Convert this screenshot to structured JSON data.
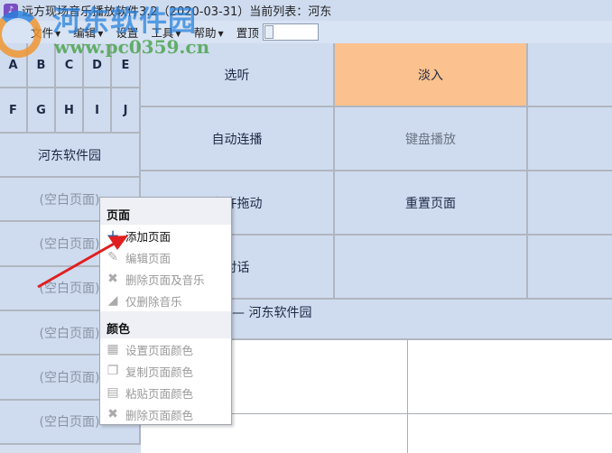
{
  "titlebar": {
    "title": "远方现场音乐播放软件3.2（2020-03-31）",
    "current_list": "当前列表：河东"
  },
  "menu": {
    "items": [
      "文件",
      "编辑",
      "设置",
      "工具",
      "帮助"
    ],
    "pin_label": "置顶"
  },
  "letters": [
    "A",
    "B",
    "C",
    "D",
    "E",
    "F",
    "G",
    "H",
    "I",
    "J"
  ],
  "pages": [
    "河东软件园",
    "(空白页面)",
    "(空白页面)",
    "(空白页面)",
    "(空白页面)",
    "(空白页面)",
    "(空白页面)"
  ],
  "grid": {
    "rows": [
      [
        "选听",
        "淡入",
        ""
      ],
      [
        "自动连播",
        "键盘播放",
        ""
      ],
      [
        "允许拖动",
        "重置页面",
        ""
      ],
      [
        "对话",
        "",
        ""
      ]
    ]
  },
  "strip_title": "— 河东软件园",
  "context_menu": {
    "page_header": "页面",
    "page_items": [
      {
        "label": "添加页面",
        "icon": "plus-icon",
        "enabled": true
      },
      {
        "label": "编辑页面",
        "icon": "pencil-icon",
        "enabled": false
      },
      {
        "label": "删除页面及音乐",
        "icon": "x-icon",
        "enabled": false
      },
      {
        "label": "仅删除音乐",
        "icon": "eraser-icon",
        "enabled": false
      }
    ],
    "color_header": "颜色",
    "color_items": [
      {
        "label": "设置页面颜色",
        "icon": "grid-icon"
      },
      {
        "label": "复制页面颜色",
        "icon": "copy-icon"
      },
      {
        "label": "粘贴页面颜色",
        "icon": "paste-icon"
      },
      {
        "label": "删除页面颜色",
        "icon": "x-icon"
      }
    ]
  },
  "watermark": {
    "name": "河东软件园",
    "url": "www.pc0359.cn"
  },
  "colors": {
    "fade_in": "#fbc18e",
    "cell": "#cfdcef",
    "arrow": "#e02020"
  }
}
